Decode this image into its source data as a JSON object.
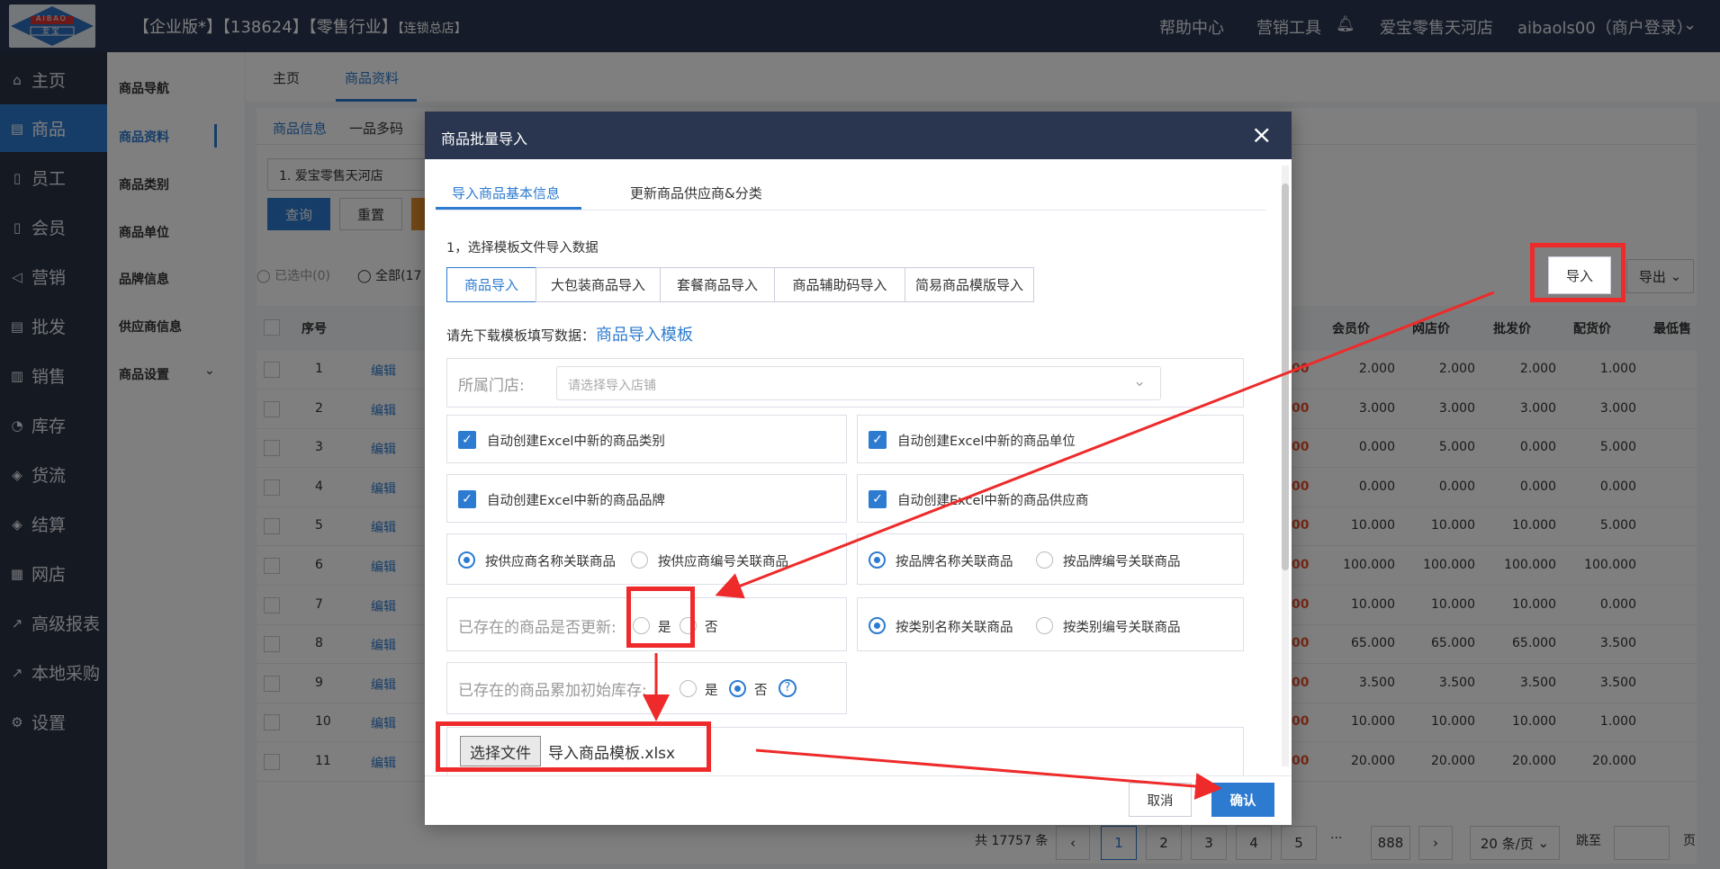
{
  "header": {
    "logo_text_top": "AIBAO",
    "logo_text_bottom": "爱 宝",
    "title": "【企业版*】【138624】【零售行业】",
    "title_small": "【连锁总店】",
    "nav": [
      "帮助中心",
      "营销工具"
    ],
    "store": "爱宝零售天河店",
    "user": "aibaols00（商户登录）"
  },
  "sidebar": {
    "items": [
      {
        "icon": "home-icon",
        "glyph": "⌂",
        "label": "主页"
      },
      {
        "icon": "goods-icon",
        "glyph": "▤",
        "label": "商品"
      },
      {
        "icon": "staff-icon",
        "glyph": "▯",
        "label": "员工"
      },
      {
        "icon": "member-icon",
        "glyph": "▯",
        "label": "会员"
      },
      {
        "icon": "marketing-icon",
        "glyph": "◁",
        "label": "营销"
      },
      {
        "icon": "wholesale-icon",
        "glyph": "▤",
        "label": "批发"
      },
      {
        "icon": "sales-icon",
        "glyph": "▥",
        "label": "销售"
      },
      {
        "icon": "stock-icon",
        "glyph": "◔",
        "label": "库存"
      },
      {
        "icon": "logistics-icon",
        "glyph": "◈",
        "label": "货流"
      },
      {
        "icon": "settlement-icon",
        "glyph": "◈",
        "label": "结算"
      },
      {
        "icon": "shop-icon",
        "glyph": "▦",
        "label": "网店"
      },
      {
        "icon": "report-icon",
        "glyph": "↗",
        "label": "高级报表"
      },
      {
        "icon": "purchase-icon",
        "glyph": "↗",
        "label": "本地采购"
      },
      {
        "icon": "settings-icon",
        "glyph": "⚙",
        "label": "设置"
      }
    ]
  },
  "subnav": {
    "items": [
      "商品导航",
      "商品资料",
      "商品类别",
      "商品单位",
      "品牌信息",
      "供应商信息",
      "商品设置"
    ]
  },
  "main": {
    "tabs": [
      "主页",
      "商品资料"
    ],
    "inner_tabs": [
      "商品信息",
      "一品多码"
    ],
    "store_select": "1. 爱宝零售天河店",
    "query": "查询",
    "reset": "重置",
    "import": "导入",
    "export": "导出",
    "selected": "已选中(0)",
    "all": "全部(17",
    "col_seq": "序号",
    "columns": [
      "会员价",
      "网店价",
      "批发价",
      "配货价",
      "最低售"
    ],
    "edit": "编辑",
    "rows": [
      {
        "n": "1",
        "v": [
          "2.000",
          "2.000",
          "2.000",
          "1.000"
        ]
      },
      {
        "n": "2",
        "v": [
          "3.000",
          "3.000",
          "3.000",
          "3.000"
        ]
      },
      {
        "n": "3",
        "v": [
          "0.000",
          "5.000",
          "0.000",
          "5.000"
        ]
      },
      {
        "n": "4",
        "v": [
          "0.000",
          "0.000",
          "0.000",
          "0.000"
        ]
      },
      {
        "n": "5",
        "v": [
          "10.000",
          "10.000",
          "10.000",
          "5.000"
        ]
      },
      {
        "n": "6",
        "v": [
          "100.000",
          "100.000",
          "100.000",
          "100.000"
        ]
      },
      {
        "n": "7",
        "v": [
          "10.000",
          "10.000",
          "10.000",
          "0.000"
        ]
      },
      {
        "n": "8",
        "v": [
          "65.000",
          "65.000",
          "65.000",
          "3.500"
        ]
      },
      {
        "n": "9",
        "v": [
          "3.500",
          "3.500",
          "3.500",
          "3.500"
        ]
      },
      {
        "n": "10",
        "v": [
          "10.000",
          "10.000",
          "10.000",
          "1.000"
        ]
      },
      {
        "n": "11",
        "v": [
          "20.000",
          "20.000",
          "20.000",
          "20.000"
        ]
      }
    ],
    "red_partial": "00",
    "pagination": {
      "total": "共 17757 条",
      "pages": [
        "1",
        "2",
        "3",
        "4",
        "5"
      ],
      "ellipsis": "···",
      "last": "888",
      "page_size": "20 条/页",
      "jump": "跳至",
      "page_unit": "页"
    }
  },
  "modal": {
    "title": "商品批量导入",
    "tabs": [
      "导入商品基本信息",
      "更新商品供应商&分类"
    ],
    "step1": "1，选择模板文件导入数据",
    "type_buttons": [
      "商品导入",
      "大包装商品导入",
      "套餐商品导入",
      "商品辅助码导入",
      "简易商品模版导入"
    ],
    "download_hint": "请先下载模板填写数据：",
    "template_link": "商品导入模板",
    "store_label": "所属门店:",
    "store_placeholder": "请选择导入店铺",
    "checks": [
      "自动创建Excel中新的商品类别",
      "自动创建Excel中新的商品单位",
      "自动创建Excel中新的商品品牌",
      "自动创建Excel中新的商品供应商"
    ],
    "supplier_radios": [
      "按供应商名称关联商品",
      "按供应商编号关联商品"
    ],
    "brand_radios": [
      "按品牌名称关联商品",
      "按品牌编号关联商品"
    ],
    "update_label": "已存在的商品是否更新:",
    "yes": "是",
    "no": "否",
    "category_radios": [
      "按类别名称关联商品",
      "按类别编号关联商品"
    ],
    "stock_label": "已存在的商品累加初始库存:",
    "choose_file": "选择文件",
    "file_name": "导入商品模板.xlsx",
    "cancel": "取消",
    "confirm": "确认"
  }
}
